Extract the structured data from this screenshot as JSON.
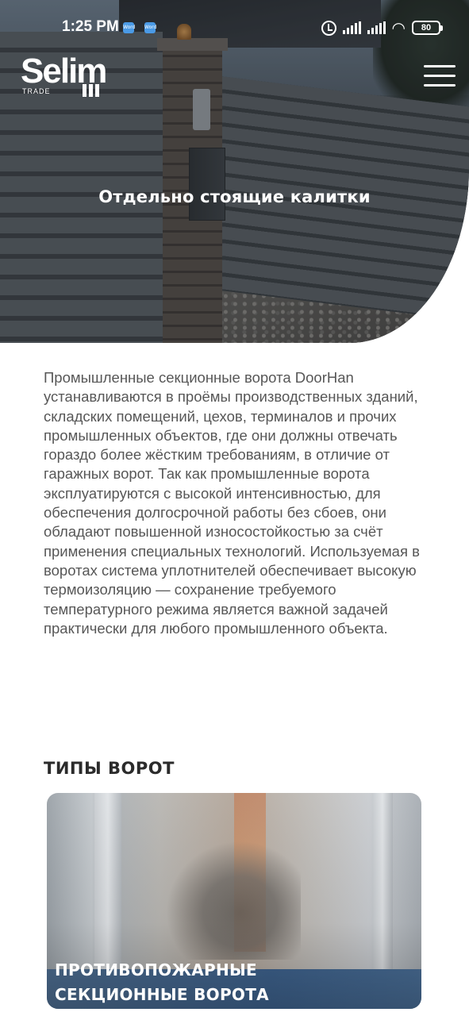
{
  "status_bar": {
    "time": "1:25 PM",
    "notification_icons": [
      "word-app-icon",
      "word-app-icon"
    ],
    "notification_icon_label": "Word",
    "battery": "80",
    "icons": [
      "alarm-icon",
      "signal-icon",
      "signal-icon",
      "wifi-icon",
      "battery-icon"
    ]
  },
  "header": {
    "logo_text": "Selim",
    "logo_subtext": "TRADE",
    "menu_icon": "hamburger-menu-icon"
  },
  "hero": {
    "title": "Отдельно стоящие калитки"
  },
  "description": "Промышленные секционные ворота DoorHan устанавливаются в проёмы производственных зданий, складских помещений, цехов, терминалов и прочих промышленных объектов, где они должны отвечать гораздо более жёстким требованиям, в отличие от гаражных ворот. Так как промышленные ворота эксплуатируются с высокой интенсивностью, для обеспечения долгосрочной работы без сбоев, они обладают повышенной износостойкостью за счёт применения специальных технологий. Используемая в воротах система уплотнителей обеспечивает высокую термоизоляцию — сохранение требуемого температурного режима является важной задачей практически для любого промышленного объекта.",
  "gate_types": {
    "title": "ТИПЫ ВОРОТ",
    "cards": [
      {
        "title": "ПРОТИВОПОЖАРНЫЕ\nСЕКЦИОННЫЕ ВОРОТА"
      }
    ]
  },
  "colors": {
    "text": "#575757",
    "heading": "#2b2b2b",
    "background": "#ffffff"
  }
}
